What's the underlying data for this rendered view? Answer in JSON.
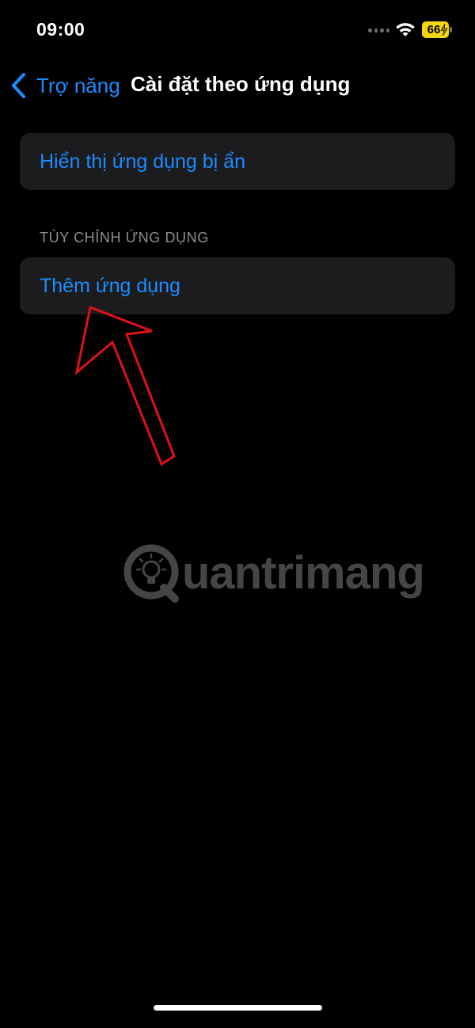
{
  "status_bar": {
    "time": "09:00",
    "battery_level": "66",
    "battery_color": "#f5d60a",
    "signal_icon": "cellular-signal-icon",
    "wifi_icon": "wifi-icon"
  },
  "nav": {
    "back_label": "Trợ năng",
    "title": "Cài đặt theo ứng dụng"
  },
  "cells": {
    "show_hidden_apps": "Hiển thị ứng dụng bị ẩn",
    "section_header": "TÙY CHỈNH ỨNG DỤNG",
    "add_app": "Thêm ứng dụng"
  },
  "annotation": {
    "arrow_color": "#e0101a",
    "arrow_target": "add_app"
  },
  "watermark": {
    "text": "uantrimang",
    "logo": "quantrimang-lightbulb-logo"
  },
  "colors": {
    "accent": "#1a8cff",
    "background": "#000000",
    "cell_background": "#1c1c1e"
  }
}
